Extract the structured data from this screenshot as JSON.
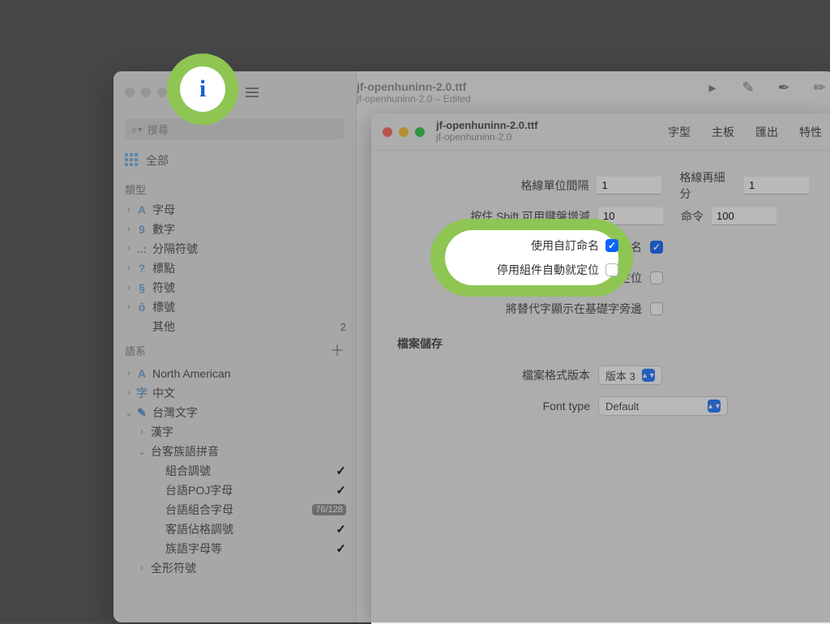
{
  "main_window": {
    "title": "jf-openhuninn-2.0.ttf",
    "subtitle": "jf-openhuninn-2.0 – Edited",
    "search_placeholder": "搜尋"
  },
  "sidebar": {
    "all_label": "全部",
    "section_type": "類型",
    "section_lang": "語系",
    "items_type": [
      {
        "icon": "A",
        "label": "字母"
      },
      {
        "icon": "9",
        "label": "數字"
      },
      {
        "icon": "..:",
        "label": "分隔符號"
      },
      {
        "icon": "?",
        "label": "標點"
      },
      {
        "icon": "§",
        "label": "符號"
      },
      {
        "icon": "ô",
        "label": "標號"
      }
    ],
    "other_label": "其他",
    "other_count": "2",
    "items_lang": [
      {
        "icon": "A",
        "label": "North American",
        "chev": "›"
      },
      {
        "icon": "字",
        "label": "中文",
        "chev": "›"
      },
      {
        "icon": "✎",
        "label": "台灣文字",
        "chev": "⌄"
      }
    ],
    "tw_children": [
      {
        "label": "漢字",
        "chev": "›"
      },
      {
        "label": "台客族語拼音",
        "chev": "⌄"
      }
    ],
    "pinyin_children": [
      {
        "label": "組合調號",
        "check": true
      },
      {
        "label": "台語POJ字母",
        "check": true
      },
      {
        "label": "台語組合字母",
        "badge": "76/128"
      },
      {
        "label": "客語佔格調號",
        "check": true
      },
      {
        "label": "族語字母等",
        "check": true
      }
    ],
    "fullwidth_label": "全形符號"
  },
  "info_panel": {
    "title": "jf-openhuninn-2.0.ttf",
    "subtitle": "jf-openhuninn-2.0",
    "tabs": [
      "字型",
      "主板",
      "匯出",
      "特性"
    ],
    "grid_unit_label": "格線單位間隔",
    "grid_unit_value": "1",
    "grid_subdiv_label": "格線再細分",
    "grid_subdiv_value": "1",
    "shift_label": "按住 Shift 可用鍵盤增減",
    "shift_value": "10",
    "cmd_label": "命令",
    "cmd_value": "100",
    "custom_name_label": "使用自訂命名",
    "disable_autopos_label": "停用組件自動就定位",
    "show_alt_label": "將替代字顯示在基礎字旁邊",
    "file_section": "檔案儲存",
    "file_version_label": "檔案格式版本",
    "file_version_value": "版本 3",
    "font_type_label": "Font type",
    "font_type_value": "Default"
  }
}
